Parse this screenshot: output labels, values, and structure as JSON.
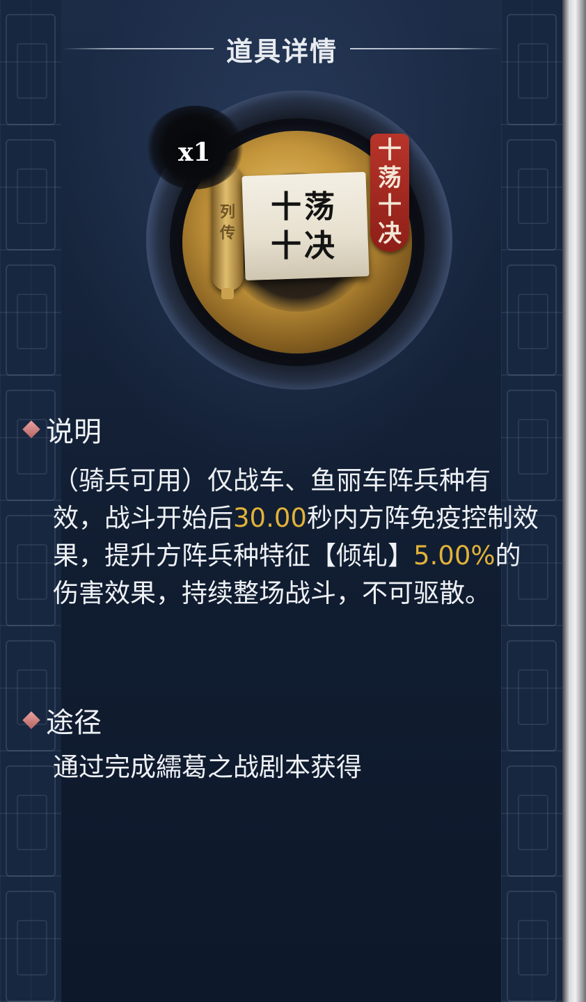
{
  "panel": {
    "title": "道具详情"
  },
  "item": {
    "quantity": "x1",
    "scroll_side_label": "列传",
    "scroll_title_line1": "十荡",
    "scroll_title_line2": "十决",
    "tag_text": "十荡十决"
  },
  "description": {
    "heading": "说明",
    "part1": "（骑兵可用）仅战车、鱼丽车阵兵种有效，战斗开始后",
    "value1": "30.00",
    "part2": "秒内方阵免疫控制效果，提升方阵兵种特征【倾轧】",
    "value2": "5.00%",
    "part3": "的伤害效果，持续整场战斗，不可驱散。"
  },
  "source": {
    "heading": "途径",
    "text": "通过完成繻葛之战剧本获得"
  },
  "colors": {
    "highlight": "#e1b23a",
    "diamond": "#c97a78",
    "background": "#16243b"
  }
}
